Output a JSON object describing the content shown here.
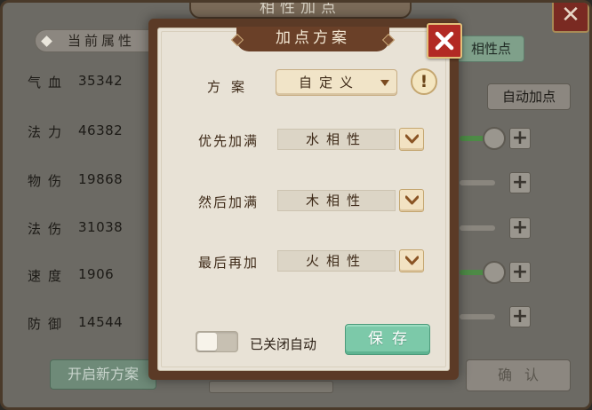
{
  "background": {
    "title": "相性加点",
    "close_icon": "close-icon",
    "attr_tab": "当前属性",
    "right_tab": "相性点",
    "auto_button": "自动加点",
    "stats": [
      {
        "label": "气血",
        "value": "35342"
      },
      {
        "label": "法力",
        "value": "46382"
      },
      {
        "label": "物伤",
        "value": "19868"
      },
      {
        "label": "法伤",
        "value": "31038"
      },
      {
        "label": "速度",
        "value": "1906"
      },
      {
        "label": "防御",
        "value": "14544"
      }
    ],
    "new_plan_button": "开启新方案",
    "confirm_button": "确认"
  },
  "modal": {
    "title": "加点方案",
    "plan_label": "方案",
    "plan_value": "自定义",
    "info_icon": "!",
    "priorities": [
      {
        "label": "优先加满",
        "value": "水相性"
      },
      {
        "label": "然后加满",
        "value": "木相性"
      },
      {
        "label": "最后再加",
        "value": "火相性"
      }
    ],
    "auto_toggle_label": "已关闭自动",
    "auto_toggle_on": false,
    "save_button": "保存"
  },
  "colors": {
    "frame": "#5b3a26",
    "panel": "#e8e2d6",
    "save": "#7cc9a9",
    "close": "#b22a24"
  }
}
